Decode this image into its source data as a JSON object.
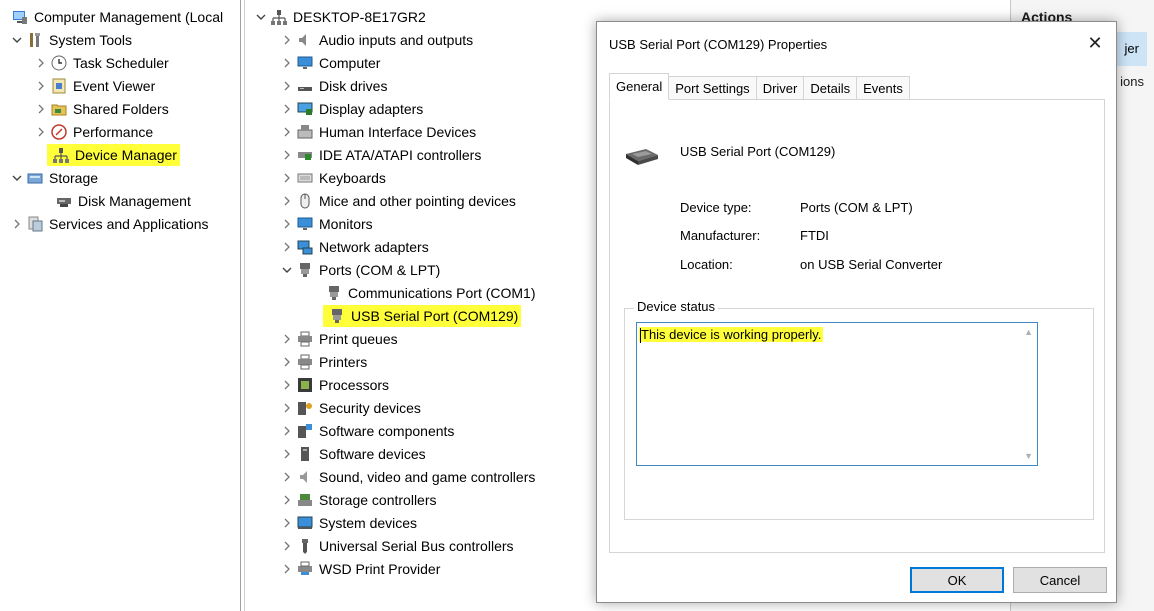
{
  "left_tree": {
    "root": "Computer Management (Local",
    "items": [
      {
        "label": "System Tools"
      },
      {
        "label": "Task Scheduler"
      },
      {
        "label": "Event Viewer"
      },
      {
        "label": "Shared Folders"
      },
      {
        "label": "Performance"
      },
      {
        "label": "Device Manager"
      },
      {
        "label": "Storage"
      },
      {
        "label": "Disk Management"
      },
      {
        "label": "Services and Applications"
      }
    ]
  },
  "device_tree": {
    "root": "DESKTOP-8E17GR2",
    "categories": [
      "Audio inputs and outputs",
      "Computer",
      "Disk drives",
      "Display adapters",
      "Human Interface Devices",
      "IDE ATA/ATAPI controllers",
      "Keyboards",
      "Mice and other pointing devices",
      "Monitors",
      "Network adapters",
      "Ports (COM & LPT)",
      "Print queues",
      "Printers",
      "Processors",
      "Security devices",
      "Software components",
      "Software devices",
      "Sound, video and game controllers",
      "Storage controllers",
      "System devices",
      "Universal Serial Bus controllers",
      "WSD Print Provider"
    ],
    "ports_children": [
      "Communications Port (COM1)",
      "USB Serial Port (COM129)"
    ]
  },
  "actions": {
    "title": "Actions",
    "selected_fragment": "jer",
    "item2_fragment": "ions"
  },
  "dialog": {
    "title": "USB Serial Port (COM129) Properties",
    "close_glyph": "✕",
    "tabs": [
      "General",
      "Port Settings",
      "Driver",
      "Details",
      "Events"
    ],
    "device_name": "USB Serial Port (COM129)",
    "props": [
      {
        "label": "Device type:",
        "value": "Ports (COM & LPT)"
      },
      {
        "label": "Manufacturer:",
        "value": "FTDI"
      },
      {
        "label": "Location:",
        "value": "on USB Serial Converter"
      }
    ],
    "status_label": "Device status",
    "status_text": "This device is working properly.",
    "ok_label": "OK",
    "cancel_label": "Cancel"
  },
  "colors": {
    "highlight": "#ffff3a",
    "accent": "#0078d7",
    "selection": "#cde4f7"
  }
}
